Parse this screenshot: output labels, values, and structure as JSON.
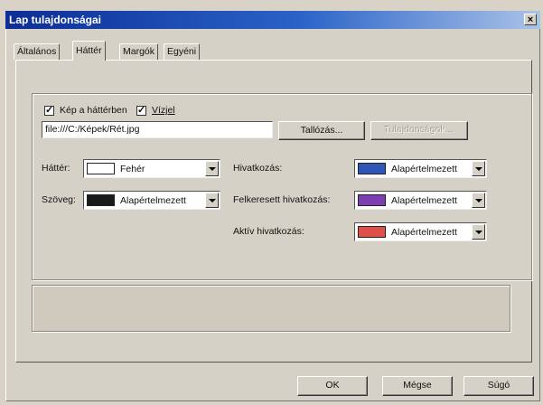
{
  "window": {
    "title": "Lap tulajdonságai",
    "close_glyph": "×"
  },
  "tabs": [
    {
      "label": "Általános"
    },
    {
      "label": "Háttér"
    },
    {
      "label": "Margók"
    },
    {
      "label": "Egyéni"
    }
  ],
  "background": {
    "image_checkbox": {
      "label": "Kép a háttérben",
      "checked": true
    },
    "watermark_checkbox": {
      "label": "Vízjel",
      "checked": true
    },
    "image_path": "file:///C:/Képek/Rét.jpg",
    "browse_label": "Tallózás...",
    "properties_label": "Tulajdonságok..."
  },
  "colors": {
    "background": {
      "label": "Háttér:",
      "value": "Fehér",
      "swatch": "#ffffff"
    },
    "text": {
      "label": "Szöveg:",
      "value": "Alapértelmezett",
      "swatch": "#1a1a1a"
    },
    "link": {
      "label": "Hivatkozás:",
      "value": "Alapértelmezett",
      "swatch": "#2d56b5"
    },
    "visited_link": {
      "label": "Felkeresett hivatkozás:",
      "value": "Alapértelmezett",
      "swatch": "#7d3fb0"
    },
    "active_link": {
      "label": "Aktív hivatkozás:",
      "value": "Alapértelmezett",
      "swatch": "#e0504a"
    }
  },
  "buttons": {
    "ok": "OK",
    "cancel": "Mégse",
    "help": "Súgó"
  }
}
